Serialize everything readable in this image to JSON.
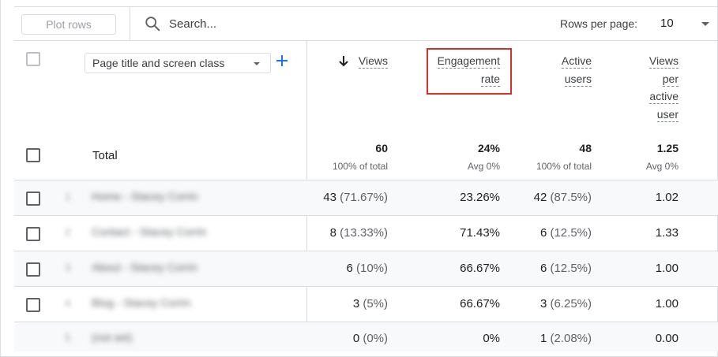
{
  "toolbar": {
    "plot_rows_label": "Plot rows",
    "search_placeholder": "Search...",
    "rows_per_page_label": "Rows per page:",
    "rows_per_page_value": "10"
  },
  "dimension": {
    "label": "Page title and screen class"
  },
  "columns": {
    "views": [
      "Views"
    ],
    "engagement_rate": [
      "Engagement",
      "rate"
    ],
    "active_users": [
      "Active",
      "users"
    ],
    "views_per_user": [
      "Views",
      "per",
      "active",
      "user"
    ]
  },
  "total": {
    "label": "Total",
    "views": "60",
    "views_sub": "100% of total",
    "engagement_rate": "24%",
    "engagement_rate_sub": "Avg 0%",
    "active_users": "48",
    "active_users_sub": "100% of total",
    "views_per_user": "1.25",
    "views_per_user_sub": "Avg 0%"
  },
  "rows": [
    {
      "index": "1",
      "title": "Home - Stacey Corrin",
      "views": "43",
      "views_pct": "(71.67%)",
      "engagement_rate": "23.26%",
      "active_users": "42",
      "active_users_pct": "(87.5%)",
      "views_per_user": "1.02"
    },
    {
      "index": "2",
      "title": "Contact - Stacey Corrin",
      "views": "8",
      "views_pct": "(13.33%)",
      "engagement_rate": "71.43%",
      "active_users": "6",
      "active_users_pct": "(12.5%)",
      "views_per_user": "1.33"
    },
    {
      "index": "3",
      "title": "About - Stacey Corrin",
      "views": "6",
      "views_pct": "(10%)",
      "engagement_rate": "66.67%",
      "active_users": "6",
      "active_users_pct": "(12.5%)",
      "views_per_user": "1.00"
    },
    {
      "index": "4",
      "title": "Blog - Stacey Corrin",
      "views": "3",
      "views_pct": "(5%)",
      "engagement_rate": "66.67%",
      "active_users": "3",
      "active_users_pct": "(6.25%)",
      "views_per_user": "1.00"
    },
    {
      "index": "5",
      "title": "(not set)",
      "views": "0",
      "views_pct": "(0%)",
      "engagement_rate": "0%",
      "active_users": "1",
      "active_users_pct": "(2.08%)",
      "views_per_user": "0.00"
    }
  ],
  "colors": {
    "accent": "#1a73e8",
    "highlight": "#d93025",
    "border": "#dadce0"
  }
}
